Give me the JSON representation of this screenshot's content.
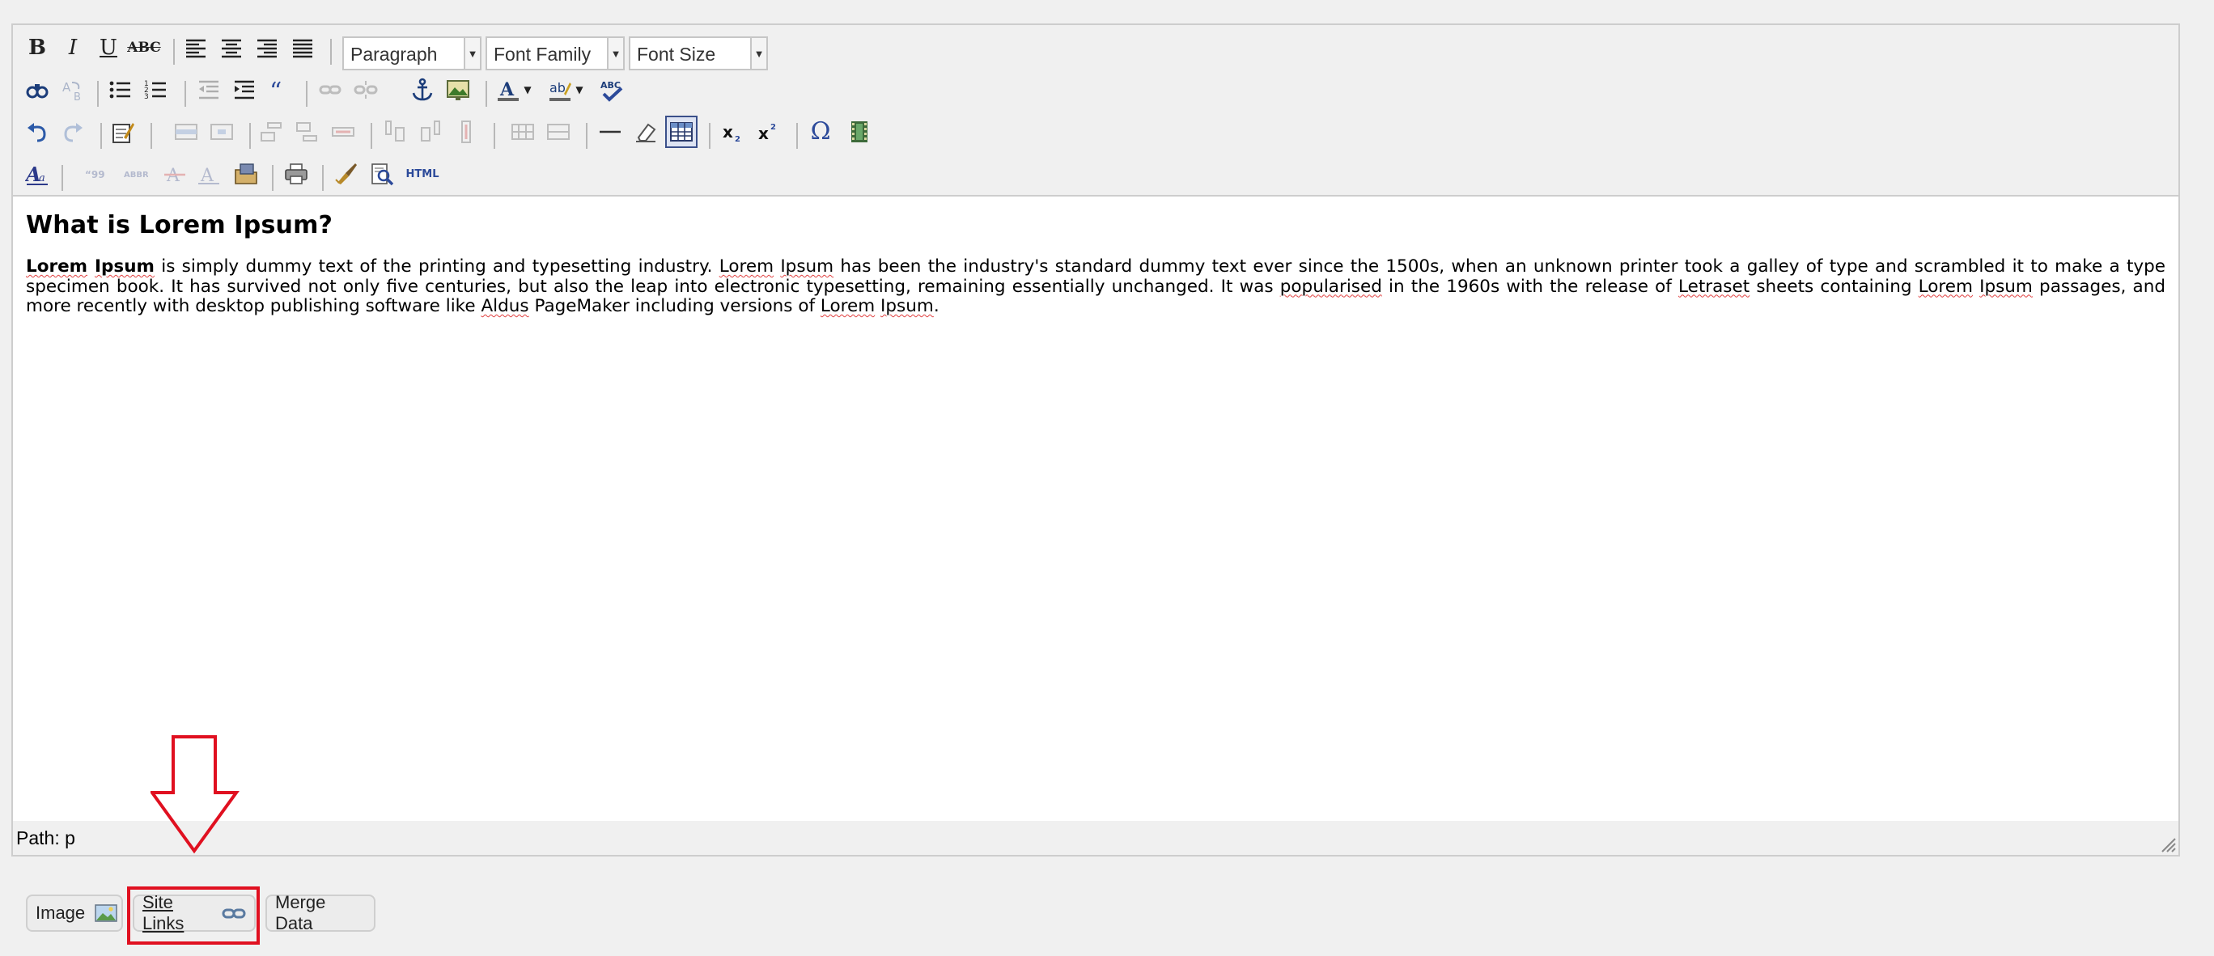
{
  "toolbar": {
    "format_select": "Paragraph",
    "font_family_select": "Font Family",
    "font_size_select": "Font Size",
    "html_button": "HTML",
    "colors": {
      "accent": "#2c4a9a",
      "annotation": "#e01020"
    }
  },
  "content": {
    "heading": "What is Lorem Ipsum?",
    "p1_bold_a": "Lorem",
    "p1_bold_b": "Ipsum",
    "p1_t1": " is simply dummy text of the printing and typesetting industry. ",
    "p1_w1": "Lorem",
    "p1_w2": "Ipsum",
    "p1_t2": " has been the industry's standard dummy text ever since the 1500s, when an unknown printer took a galley of type and scrambled it to make a type specimen book. It has survived not only five centuries, but also the leap into electronic typesetting, remaining essentially unchanged. It was ",
    "p1_w3": "popularised",
    "p1_t3": " in the 1960s with the release of ",
    "p1_w4": "Letraset",
    "p1_t4": " sheets containing ",
    "p1_w5": "Lorem",
    "p1_w6": "Ipsum",
    "p1_t5": " passages, and more recently with desktop publishing software like ",
    "p1_w7": "Aldus",
    "p1_t6": " PageMaker including versions of ",
    "p1_w8": "Lorem",
    "p1_w9": "Ipsum",
    "p1_t7": "."
  },
  "statusbar": {
    "path_label": "Path:",
    "path_value": "p"
  },
  "buttons": {
    "image": "Image",
    "site_links": "Site Links",
    "merge_data": "Merge Data"
  }
}
